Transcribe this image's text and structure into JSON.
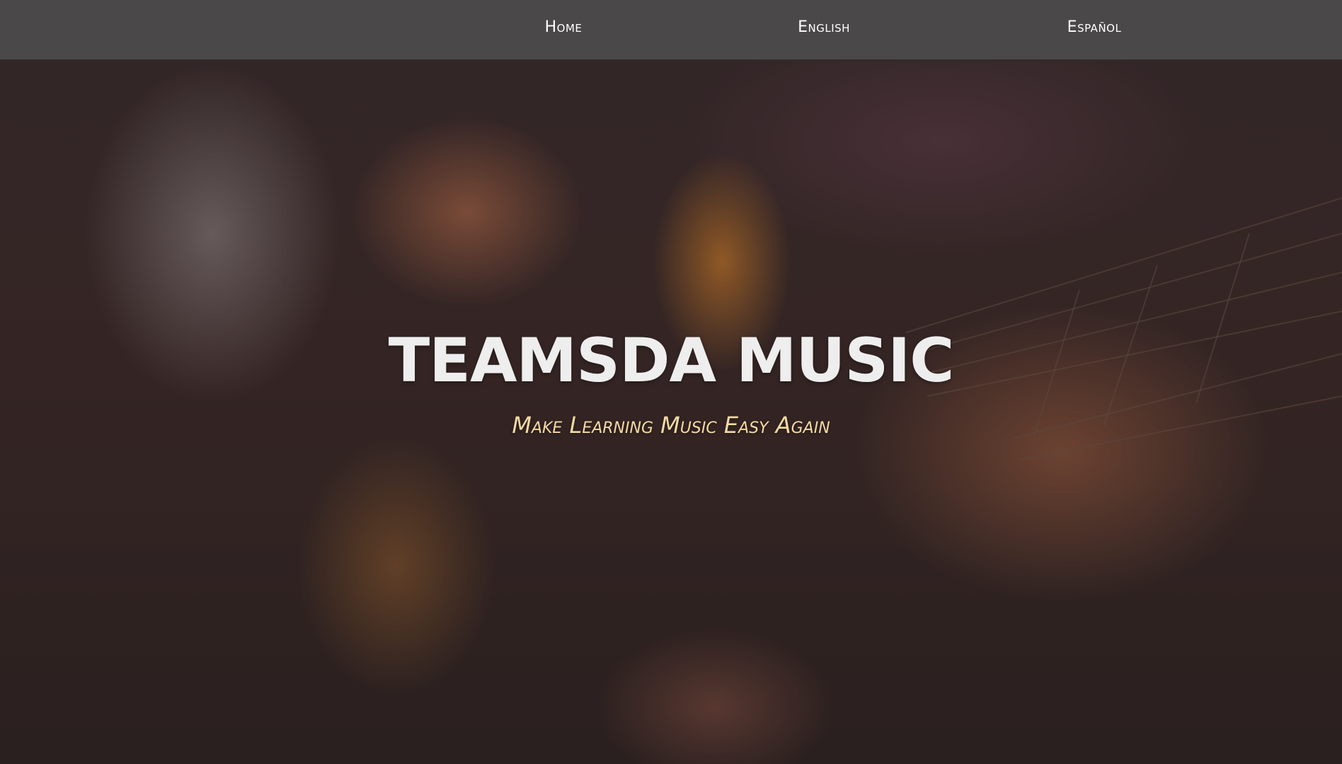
{
  "nav": {
    "items": [
      {
        "label": "Home"
      },
      {
        "label": "English"
      },
      {
        "label": "Español"
      }
    ]
  },
  "hero": {
    "title": "TEAMSDA MUSIC",
    "subtitle": "Make Learning Music Easy Again",
    "background_image": "guitar-playing-photo"
  },
  "colors": {
    "navbar": "#4a4848",
    "title": "#eeeeee",
    "subtitle": "#f4d9a4"
  }
}
